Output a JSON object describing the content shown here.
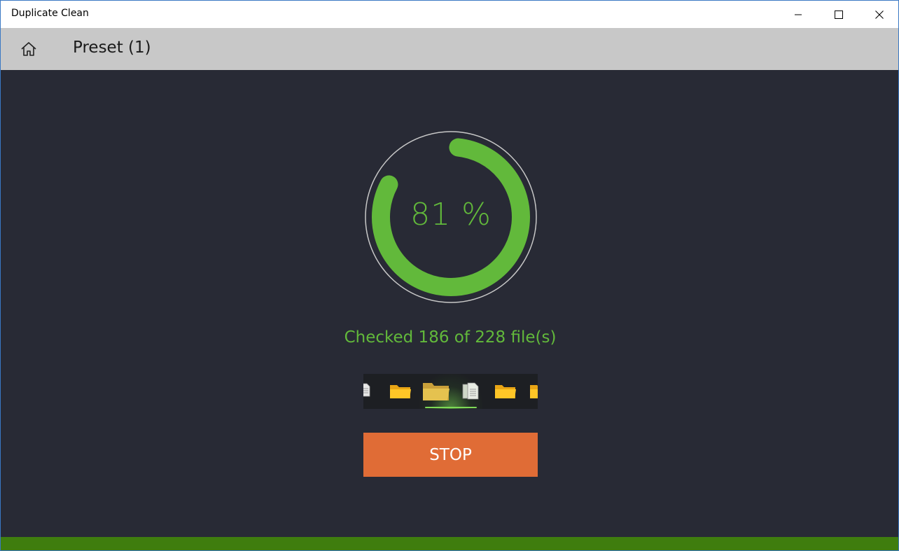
{
  "window": {
    "title": "Duplicate Clean"
  },
  "header": {
    "title": "Preset (1)"
  },
  "progress": {
    "percent": 81,
    "label": "81 %",
    "status": "Checked 186 of 228 file(s)"
  },
  "actions": {
    "stop_label": "STOP"
  },
  "colors": {
    "accent_green": "#62b93b",
    "stop_orange": "#e06c36",
    "footer_green": "#3f7d0e",
    "background": "#282a35"
  },
  "icons": {
    "home": "home-icon",
    "minimize": "minimize-icon",
    "maximize": "maximize-icon",
    "close": "close-icon",
    "folder": "folder-icon",
    "document": "document-icon"
  }
}
